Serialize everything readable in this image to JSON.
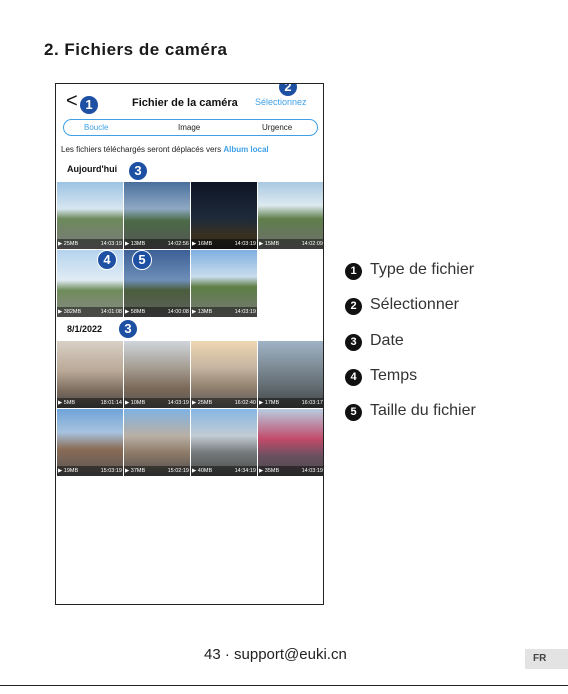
{
  "heading": "2. Fichiers de caméra",
  "app": {
    "back": "<",
    "title": "Fichier de la caméra",
    "select": "Sélectionnez",
    "tabs": [
      "Boucle",
      "Image",
      "Urgence"
    ],
    "info_text": "Les fichiers téléchargés seront déplacés vers ",
    "info_link": "Album local",
    "groups": [
      {
        "date": "Aujourd'hui",
        "thumbs": [
          {
            "size": "▶ 25MB",
            "time": "14:03:19"
          },
          {
            "size": "▶ 13MB",
            "time": "14:02:56"
          },
          {
            "size": "▶ 16MB",
            "time": "14:03:19"
          },
          {
            "size": "▶ 15MB",
            "time": "14:02:09"
          },
          {
            "size": "▶ 382MB",
            "time": "14:01:08"
          },
          {
            "size": "▶ 58MB",
            "time": "14:00:08"
          },
          {
            "size": "▶ 13MB",
            "time": "14:03:19"
          }
        ]
      },
      {
        "date": "8/1/2022",
        "thumbs": [
          {
            "size": "▶ 5MB",
            "time": "18:01:14"
          },
          {
            "size": "▶ 10MB",
            "time": "14:03:19"
          },
          {
            "size": "▶ 25MB",
            "time": "16:02:40"
          },
          {
            "size": "▶ 17MB",
            "time": "16:03:17"
          },
          {
            "size": "▶ 19MB",
            "time": "15:03:19"
          },
          {
            "size": "▶ 37MB",
            "time": "15:02:19"
          },
          {
            "size": "▶ 40MB",
            "time": "14:34:19"
          },
          {
            "size": "▶ 35MB",
            "time": "14:03:19"
          }
        ]
      }
    ]
  },
  "callouts": [
    "1",
    "2",
    "3",
    "3",
    "4",
    "5"
  ],
  "legend": [
    {
      "num": "1",
      "label": "Type de fichier"
    },
    {
      "num": "2",
      "label": "Sélectionner"
    },
    {
      "num": "3",
      "label": "Date"
    },
    {
      "num": "4",
      "label": "Temps"
    },
    {
      "num": "5",
      "label": "Taille du fichier"
    }
  ],
  "footer": "43 · support@euki.cn",
  "lang": "FR",
  "colors": {
    "accent": "#3fa0e6",
    "badge": "#1d4fa3"
  }
}
